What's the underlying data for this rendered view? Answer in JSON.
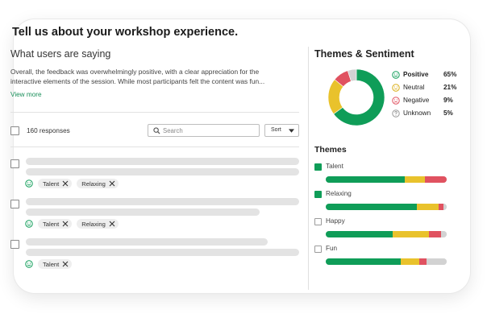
{
  "page": {
    "title": "Tell us about your workshop experience."
  },
  "feedback": {
    "section_title": "What users are saying",
    "summary": "Overall, the feedback was overwhelmingly positive, with a clear appreciation for the interactive elements of the session. While most participants felt the content was fun...",
    "view_more_label": "View more",
    "responses_label": "160 responses",
    "search": {
      "placeholder": "Search",
      "value": ""
    },
    "sort_label": "Sort",
    "responses": [
      {
        "sentiment_icon": "smile-icon",
        "tags": [
          "Talent",
          "Relaxing"
        ]
      },
      {
        "sentiment_icon": "smile-icon",
        "tags": [
          "Talent",
          "Relaxing"
        ]
      },
      {
        "sentiment_icon": "smile-icon",
        "tags": [
          "Talent"
        ]
      }
    ]
  },
  "analysis": {
    "title": "Themes & Sentiment",
    "sentiment": [
      {
        "label": "Positive",
        "percent_label": "65%",
        "value": 65,
        "color": "#0f9d58",
        "icon": "smile-icon"
      },
      {
        "label": "Neutral",
        "percent_label": "21%",
        "value": 21,
        "color": "#e9c22c",
        "icon": "neutral-face-icon"
      },
      {
        "label": "Negative",
        "percent_label": "9%",
        "value": 9,
        "color": "#e05260",
        "icon": "frown-icon"
      },
      {
        "label": "Unknown",
        "percent_label": "5%",
        "value": 5,
        "color": "#d2d2d2",
        "icon": "question-icon"
      }
    ],
    "themes_title": "Themes",
    "themes": [
      {
        "name": "Talent",
        "checked": true,
        "split": [
          65,
          17,
          18,
          0
        ]
      },
      {
        "name": "Relaxing",
        "checked": true,
        "split": [
          75,
          18,
          4,
          3
        ]
      },
      {
        "name": "Happy",
        "checked": false,
        "split": [
          55,
          30,
          10,
          5
        ]
      },
      {
        "name": "Fun",
        "checked": false,
        "split": [
          62,
          15,
          6,
          17
        ]
      }
    ]
  }
}
